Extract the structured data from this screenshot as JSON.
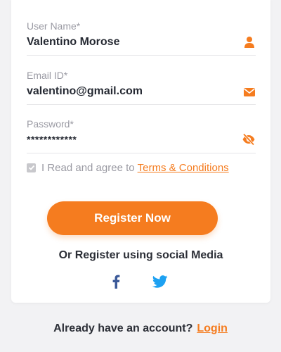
{
  "form": {
    "username": {
      "label": "User Name*",
      "value": "Valentino Morose",
      "icon": "user-icon"
    },
    "email": {
      "label": "Email ID*",
      "value": "valentino@gmail.com",
      "icon": "envelope-icon"
    },
    "password": {
      "label": "Password*",
      "value": "************",
      "icon": "eye-slash-icon"
    },
    "agree": {
      "text": "I Read and agree to",
      "link": "Terms & Conditions",
      "checked": true
    },
    "register_button": "Register Now",
    "social_title": "Or Register using social Media",
    "social_icons": [
      "facebook-icon",
      "twitter-icon"
    ]
  },
  "footer": {
    "text": "Already have an account?",
    "login_link": "Login"
  },
  "colors": {
    "accent": "#f57c1f",
    "background": "#f2f2f4",
    "card": "#ffffff",
    "label": "#9a9aa3",
    "text": "#262a33",
    "facebook": "#3b5998",
    "twitter": "#1da1f2"
  }
}
